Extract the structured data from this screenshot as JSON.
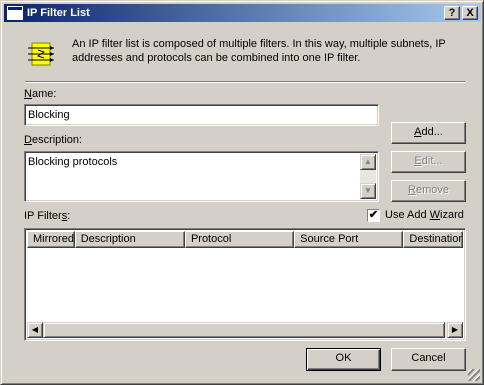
{
  "window": {
    "title": "IP Filter List",
    "help_glyph": "?",
    "close_glyph": "X"
  },
  "intro": {
    "text": "An IP filter list is composed of multiple filters. In this way, multiple subnets, IP addresses and protocols can be combined into one IP filter.",
    "icon": "ip-filter-list-icon"
  },
  "name": {
    "label_accel": "N",
    "label_rest": "ame:",
    "value": "Blocking"
  },
  "description": {
    "label_accel": "D",
    "label_rest": "escription:",
    "value": "Blocking protocols"
  },
  "buttons": {
    "add_accel": "A",
    "add_rest": "dd...",
    "edit_accel": "E",
    "edit_rest": "dit...",
    "remove_accel": "R",
    "remove_rest": "emove",
    "ok": "OK",
    "cancel": "Cancel"
  },
  "wizard": {
    "label_pre": "Use Add ",
    "label_accel": "W",
    "label_post": "izard",
    "checked": true,
    "check_glyph": "✔"
  },
  "filters": {
    "label_pre": "IP Filter",
    "label_accel": "s",
    "label_post": ":",
    "columns": [
      "Mirrored",
      "Description",
      "Protocol",
      "Source Port",
      "Destination"
    ],
    "rows": []
  },
  "scroll_glyphs": {
    "up": "▲",
    "down": "▼",
    "left": "◀",
    "right": "▶"
  }
}
